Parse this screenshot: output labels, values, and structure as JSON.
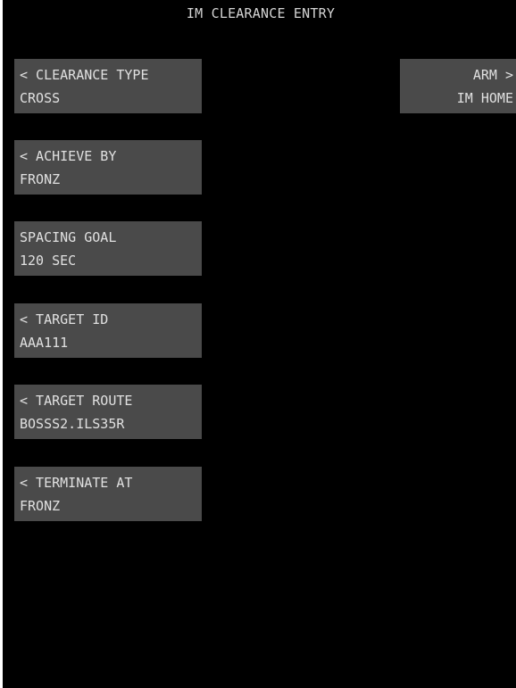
{
  "header": {
    "title": "IM CLEARANCE ENTRY"
  },
  "colors": {
    "background": "#000000",
    "button": "#4a4a4a",
    "text": "#e0e0e0"
  },
  "left_keys": [
    {
      "label": "< CLEARANCE TYPE",
      "value": "CROSS"
    },
    {
      "label": "< ACHIEVE BY",
      "value": "FRONZ"
    },
    {
      "label": "SPACING GOAL",
      "value": "120 SEC"
    },
    {
      "label": "< TARGET ID",
      "value": "AAA111"
    },
    {
      "label": "< TARGET ROUTE",
      "value": "BOSSS2.ILS35R"
    },
    {
      "label": "< TERMINATE AT",
      "value": "FRONZ"
    }
  ],
  "right_keys": [
    {
      "label": "ARM >",
      "value": "IM HOME"
    }
  ]
}
